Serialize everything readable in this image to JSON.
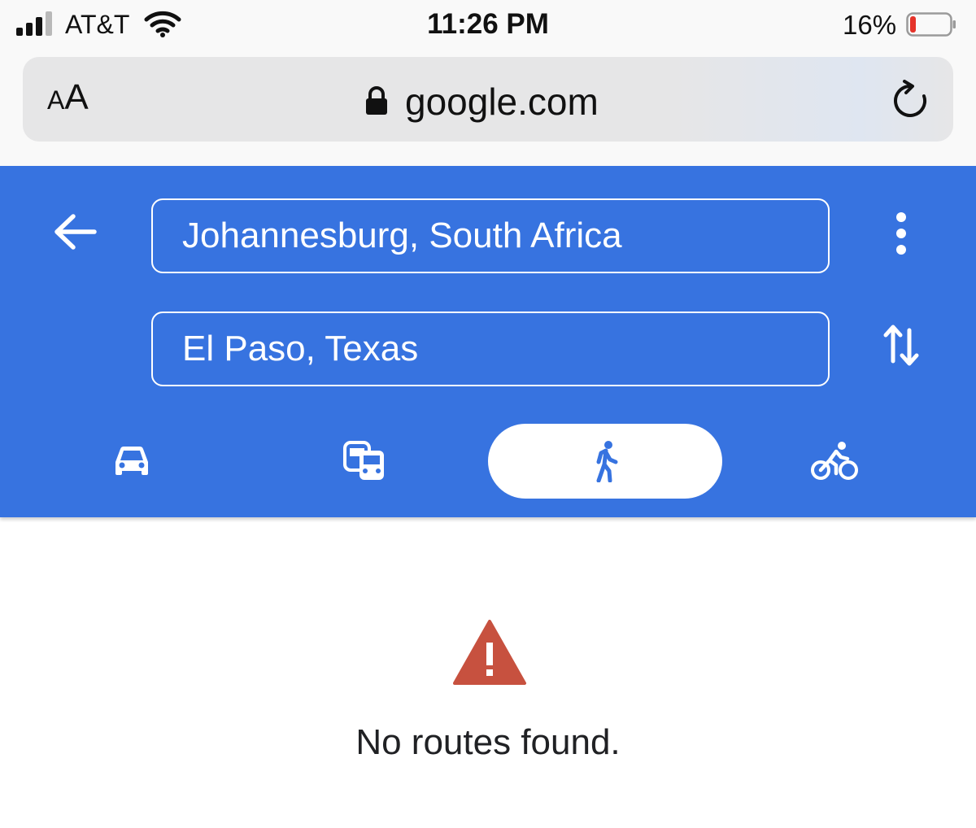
{
  "status_bar": {
    "carrier": "AT&T",
    "time": "11:26 PM",
    "battery_percent": "16%",
    "battery_level": 0.16,
    "battery_color": "#e5332a",
    "signal_bars": 3
  },
  "browser": {
    "text_size_button": {
      "small": "A",
      "large": "A"
    },
    "url": "google.com",
    "icons": [
      "lock-icon",
      "reload-icon"
    ]
  },
  "directions": {
    "header_color": "#3773e0",
    "origin": "Johannesburg, South Africa",
    "destination": "El Paso, Texas",
    "icons": [
      "back-arrow-icon",
      "more-vert-icon",
      "swap-icon"
    ],
    "travel_modes": [
      {
        "name": "drive",
        "icon": "car-icon",
        "selected": false
      },
      {
        "name": "transit",
        "icon": "transit-icon",
        "selected": false
      },
      {
        "name": "walk",
        "icon": "walk-icon",
        "selected": true
      },
      {
        "name": "bike",
        "icon": "bike-icon",
        "selected": false
      }
    ]
  },
  "result": {
    "icon": "warning-icon",
    "warning_color": "#c7513f",
    "message": "No routes found."
  }
}
